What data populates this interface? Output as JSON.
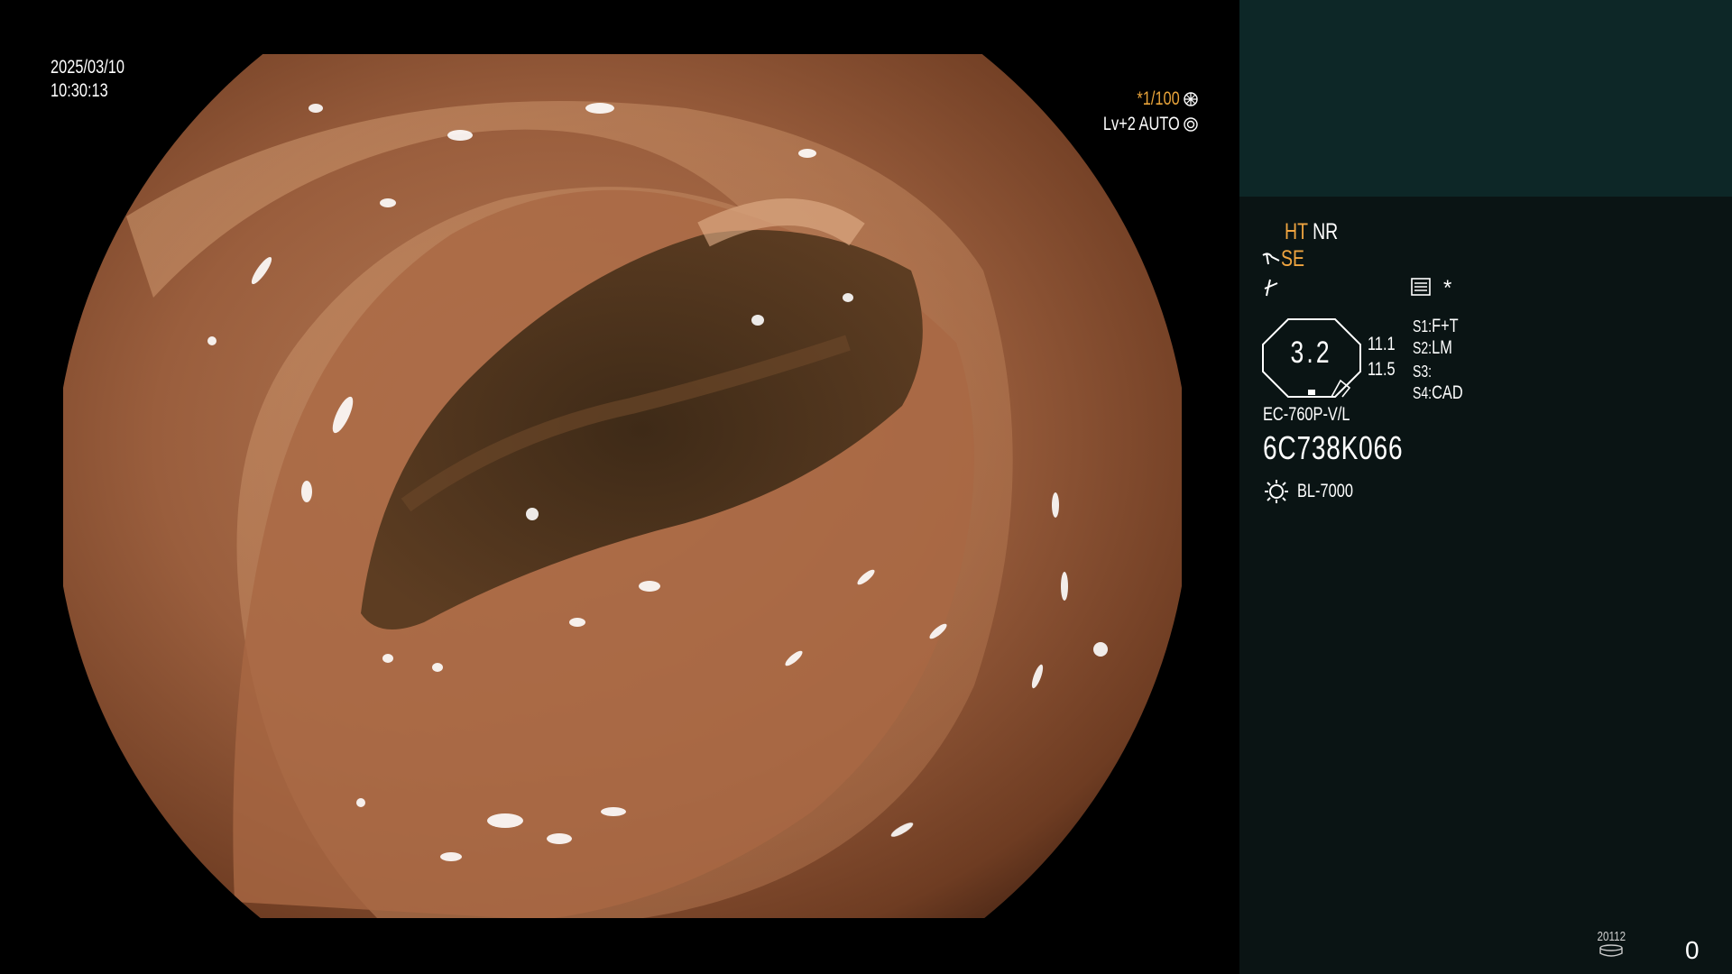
{
  "osd": {
    "date": "2025/03/10",
    "time": "10:30:13",
    "shutter": "*1/100",
    "level": "Lv+2 AUTO"
  },
  "panel": {
    "mode_ht": "HT",
    "mode_nr": "NR",
    "mode_se": "SE",
    "star": "*",
    "zoom_value": "3.2",
    "side_values": [
      "11.1",
      "11.5"
    ],
    "switches": [
      {
        "label": "S1:",
        "value": "F+T"
      },
      {
        "label": "S2:",
        "value": "LM"
      },
      {
        "label": "S3:",
        "value": ""
      },
      {
        "label": "S4:",
        "value": "CAD"
      }
    ],
    "scope_model": "EC-760P-V/L",
    "scope_serial": "6C738K066",
    "light_source": "BL-7000",
    "storage_count": "20112",
    "counter": "0"
  },
  "colors": {
    "accent_orange": "#f0a540",
    "panel_top": "#0d2727",
    "panel_bg": "#0a1414"
  },
  "icons": [
    "shutter-ring-icon",
    "iris-ring-icon",
    "hook-icon",
    "cut-icon",
    "menu-list-icon",
    "light-bulb-icon",
    "storage-icon"
  ]
}
